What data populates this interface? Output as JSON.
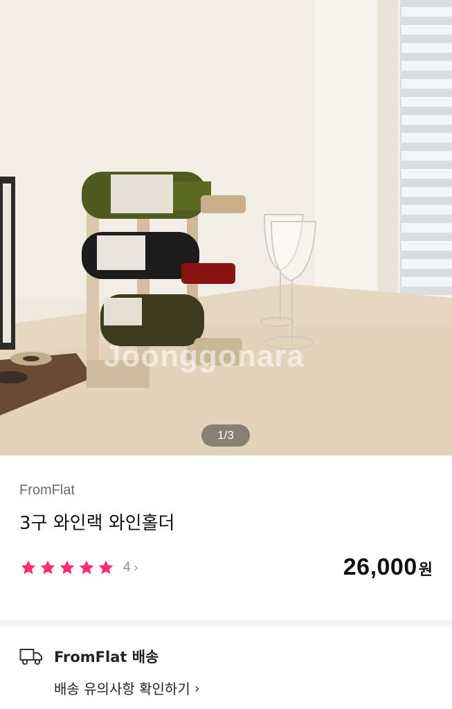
{
  "product": {
    "image_counter": "1/3",
    "watermark": "Joonggonara",
    "brand": "FromFlat",
    "title": "3구 와인랙 와인홀더",
    "rating": {
      "stars": 5,
      "review_count": "4",
      "chevron": "›"
    },
    "price": {
      "amount": "26,000",
      "unit": "원"
    }
  },
  "delivery": {
    "icon": "truck-icon",
    "title": "FromFlat 배송",
    "notice_link": "배송 유의사항 확인하기",
    "chevron": "›"
  },
  "colors": {
    "star": "#ff2d6a",
    "text_primary": "#111111",
    "text_secondary": "#6b6b6b",
    "divider": "#f3f3f3"
  }
}
